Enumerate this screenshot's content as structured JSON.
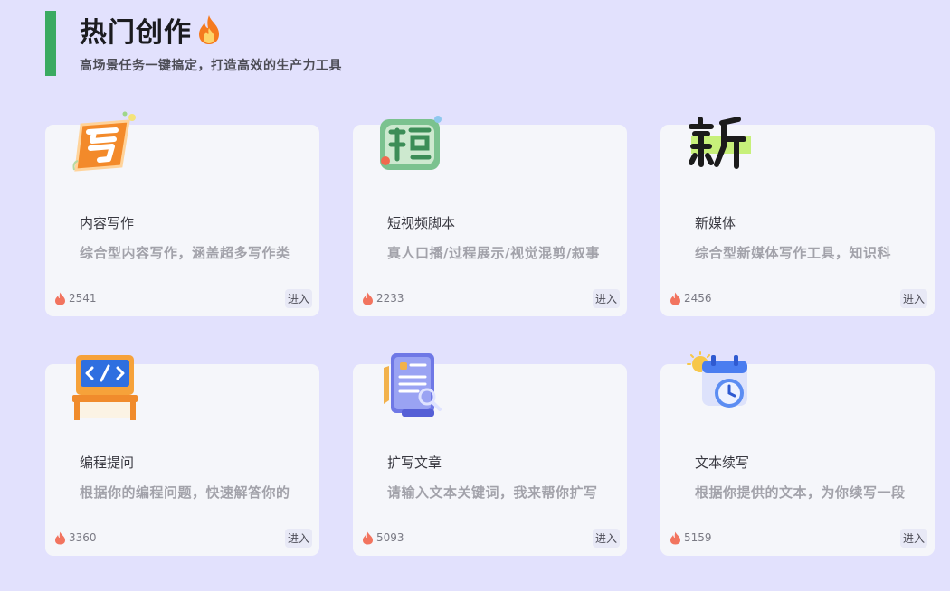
{
  "header": {
    "title": "热门创作",
    "title_icon": "fire-icon",
    "subtitle": "高场景任务一键搞定，打造高效的生产力工具",
    "accent_color": "#3aaa61"
  },
  "cards": [
    {
      "title": "内容写作",
      "description": "综合型内容写作，涵盖超多写作类型",
      "views": "2541",
      "enter_label": "进入",
      "icon": "write-character-icon"
    },
    {
      "title": "短视频脚本",
      "description": "真人口播/过程展示/视觉混剪/叙事讲述，让你一键生成多组脚本",
      "views": "2233",
      "enter_label": "进入",
      "icon": "short-character-icon"
    },
    {
      "title": "新媒体",
      "description": "综合型新媒体写作工具，知识科普、日常分享、情感话题",
      "views": "2456",
      "enter_label": "进入",
      "icon": "new-character-icon"
    },
    {
      "title": "编程提问",
      "description": "根据你的编程问题，快速解答你的技术难题",
      "views": "3360",
      "enter_label": "进入",
      "icon": "code-monitor-icon"
    },
    {
      "title": "扩写文章",
      "description": "请输入文本关键词，我来帮你扩写",
      "views": "5093",
      "enter_label": "进入",
      "icon": "document-scroll-icon"
    },
    {
      "title": "文本续写",
      "description": "根据你提供的文本，为你续写一段故事内容",
      "views": "5159",
      "enter_label": "进入",
      "icon": "calendar-clock-icon"
    }
  ]
}
